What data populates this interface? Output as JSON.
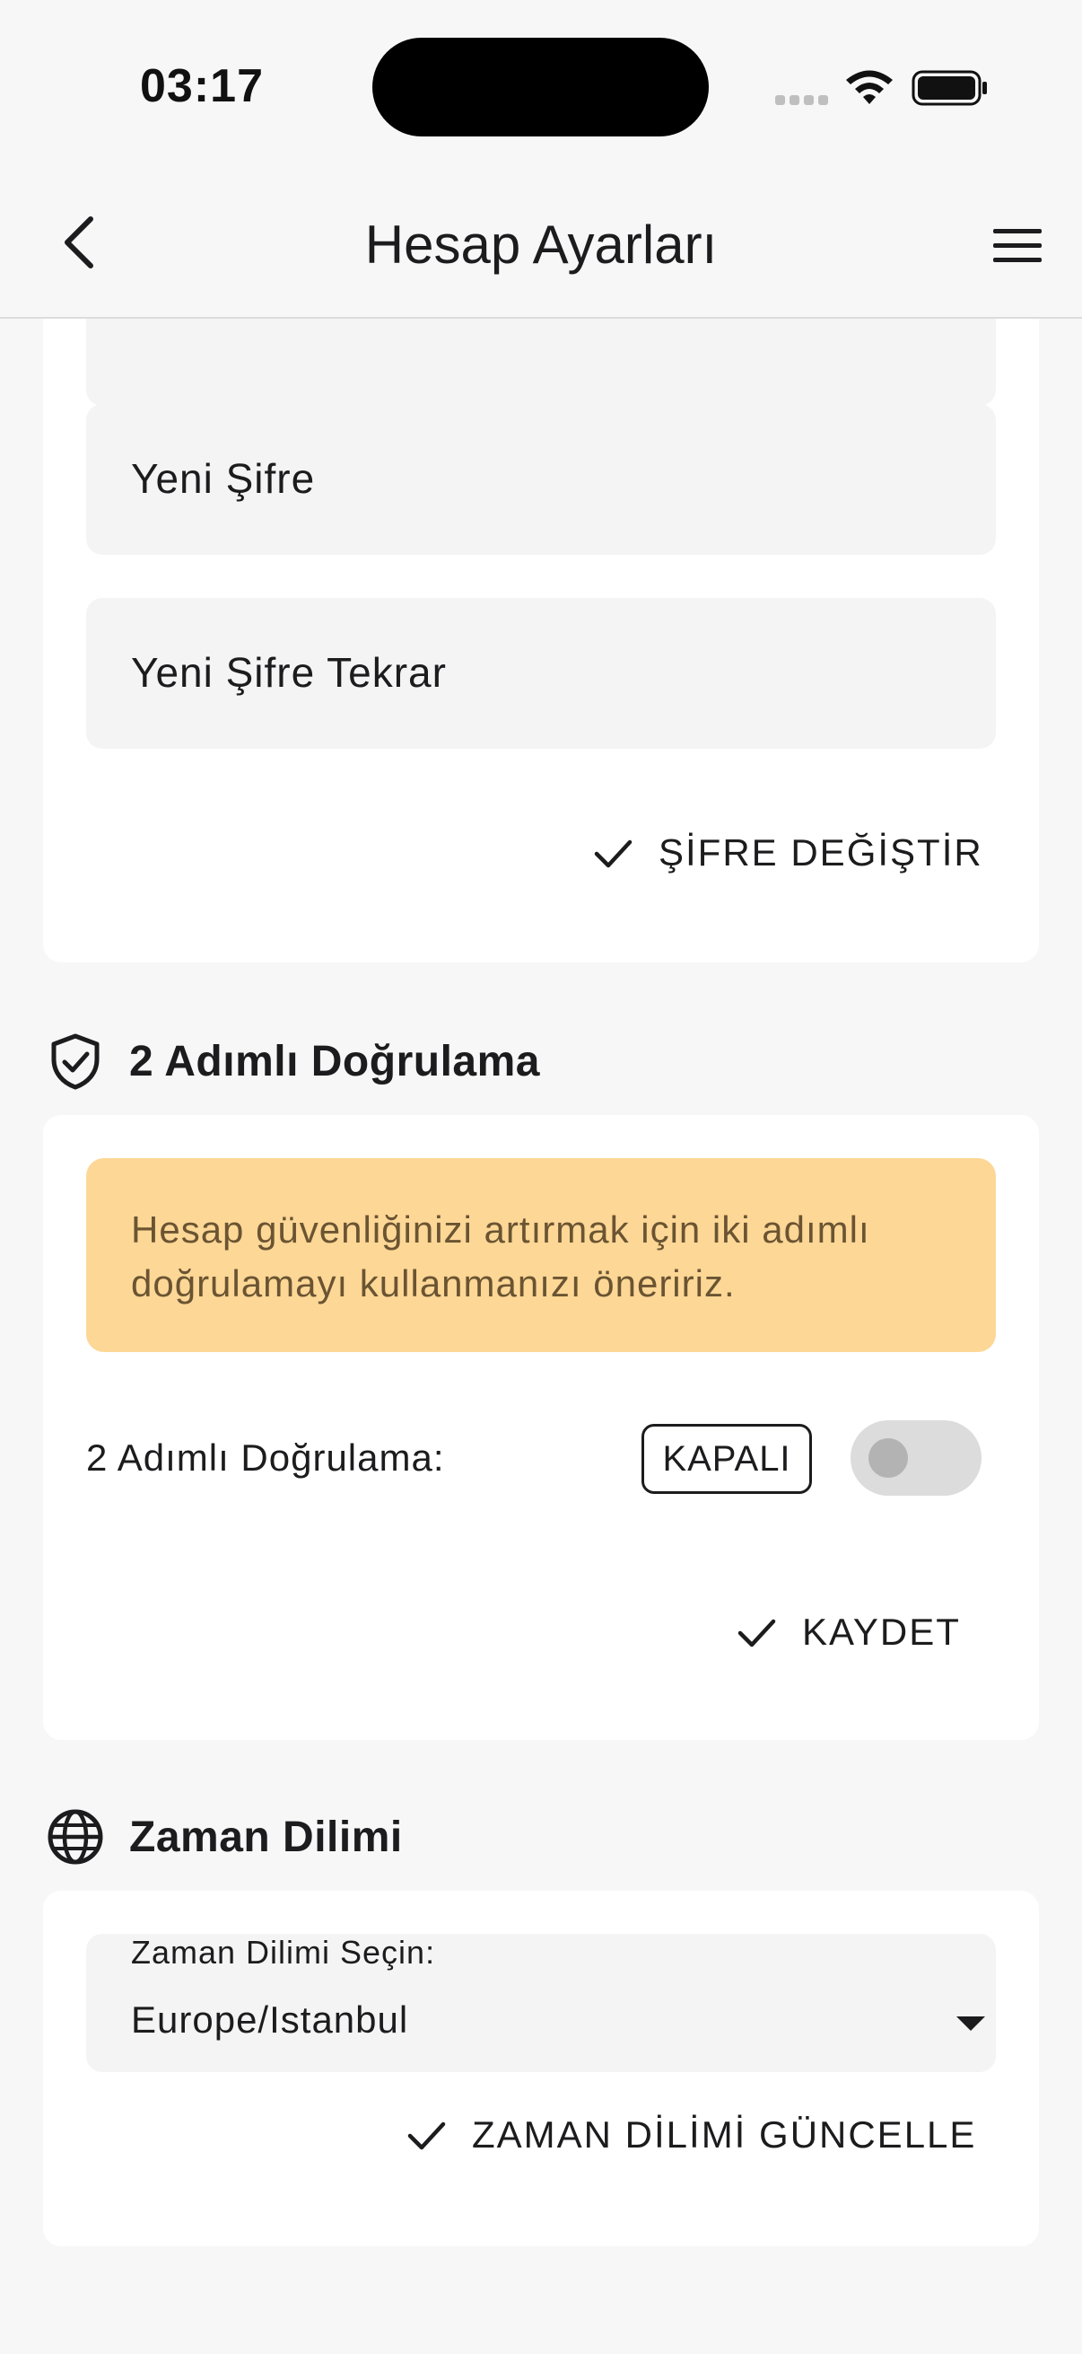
{
  "status_bar": {
    "time": "03:17"
  },
  "header": {
    "title": "Hesap Ayarları"
  },
  "password": {
    "new_password_placeholder": "Yeni Şifre",
    "repeat_password_placeholder": "Yeni Şifre Tekrar",
    "change_button": "ŞİFRE DEĞİŞTİR"
  },
  "two_factor": {
    "section_title": "2 Adımlı Doğrulama",
    "warning_text": "Hesap güvenliğinizi artırmak için iki adımlı doğrulamayı kullanmanızı öneririz.",
    "setting_label": "2 Adımlı Doğrulama:",
    "status_badge": "KAPALI",
    "save_button": "KAYDET"
  },
  "timezone": {
    "section_title": "Zaman Dilimi",
    "select_label": "Zaman Dilimi Seçin:",
    "selected_value": "Europe/Istanbul",
    "update_button": "ZAMAN DİLİMİ GÜNCELLE"
  }
}
